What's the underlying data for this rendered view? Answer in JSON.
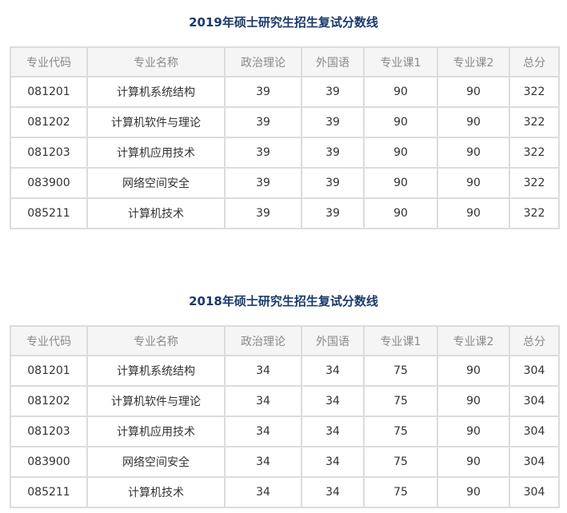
{
  "headers": [
    "专业代码",
    "专业名称",
    "政治理论",
    "外国语",
    "专业课1",
    "专业课2",
    "总分"
  ],
  "sections": [
    {
      "title": "2019年硕士研究生招生复试分数线",
      "rows": [
        [
          "081201",
          "计算机系统结构",
          "39",
          "39",
          "90",
          "90",
          "322"
        ],
        [
          "081202",
          "计算机软件与理论",
          "39",
          "39",
          "90",
          "90",
          "322"
        ],
        [
          "081203",
          "计算机应用技术",
          "39",
          "39",
          "90",
          "90",
          "322"
        ],
        [
          "083900",
          "网络空间安全",
          "39",
          "39",
          "90",
          "90",
          "322"
        ],
        [
          "085211",
          "计算机技术",
          "39",
          "39",
          "90",
          "90",
          "322"
        ]
      ]
    },
    {
      "title": "2018年硕士研究生招生复试分数线",
      "rows": [
        [
          "081201",
          "计算机系统结构",
          "34",
          "34",
          "75",
          "90",
          "304"
        ],
        [
          "081202",
          "计算机软件与理论",
          "34",
          "34",
          "75",
          "90",
          "304"
        ],
        [
          "081203",
          "计算机应用技术",
          "34",
          "34",
          "75",
          "90",
          "304"
        ],
        [
          "083900",
          "网络空间安全",
          "34",
          "34",
          "75",
          "90",
          "304"
        ],
        [
          "085211",
          "计算机技术",
          "34",
          "34",
          "75",
          "90",
          "304"
        ]
      ]
    }
  ]
}
